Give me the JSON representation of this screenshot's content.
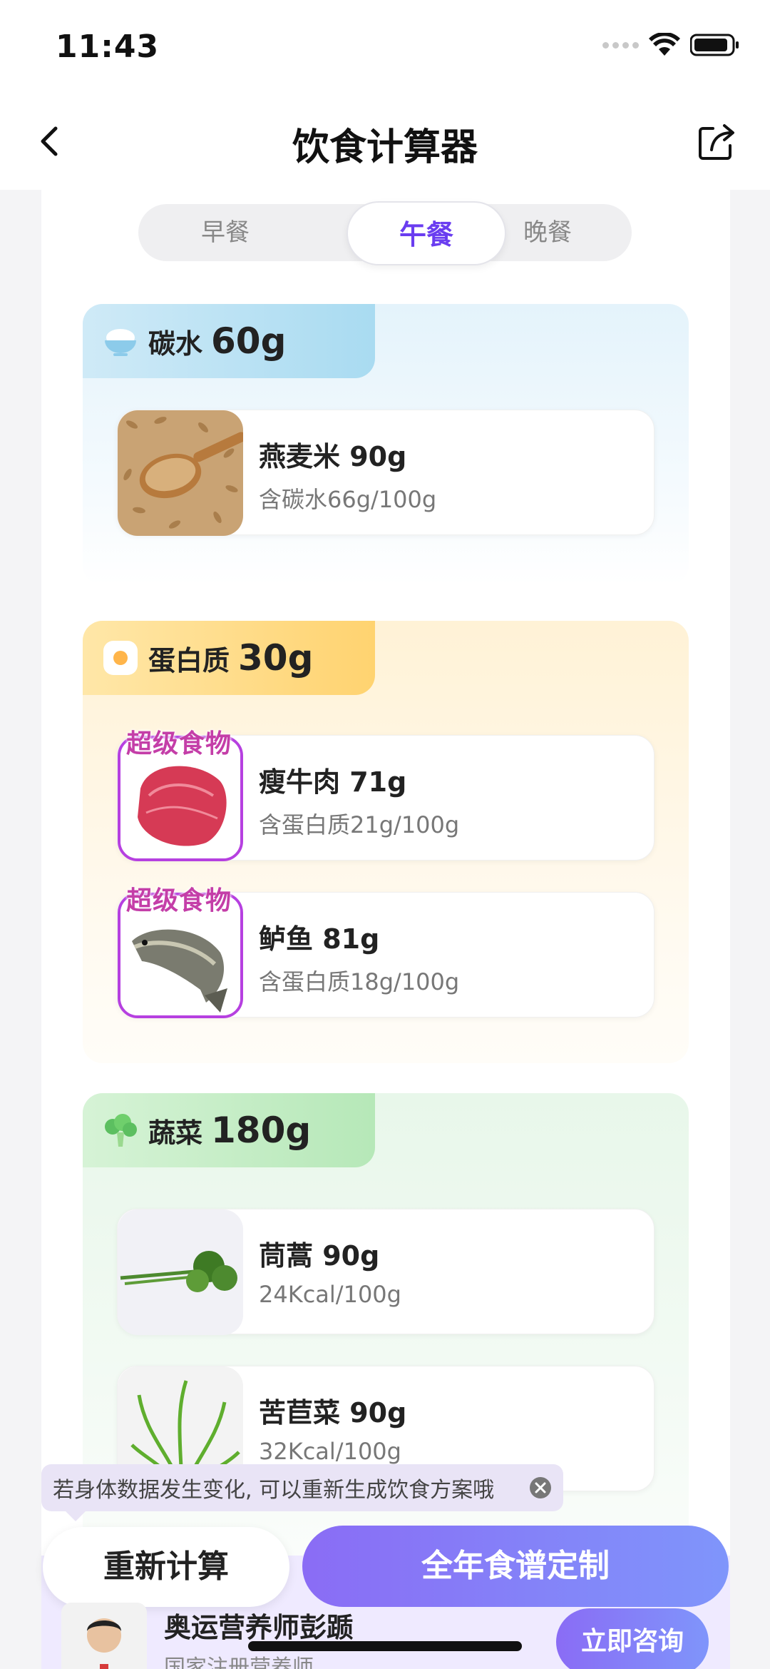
{
  "status": {
    "time": "11:43"
  },
  "nav": {
    "title": "饮食计算器"
  },
  "tabs": [
    {
      "label": "早餐",
      "active": false
    },
    {
      "label": "午餐",
      "active": true
    },
    {
      "label": "晚餐",
      "active": false
    }
  ],
  "sections": {
    "carb": {
      "name": "碳水",
      "amount": "60g",
      "icon": "rice-bowl-icon",
      "foods": [
        {
          "name": "燕麦米 90g",
          "desc": "含碳水66g/100g",
          "super": false
        }
      ]
    },
    "protein": {
      "name": "蛋白质",
      "amount": "30g",
      "icon": "egg-icon",
      "foods": [
        {
          "name": "瘦牛肉 71g",
          "desc": "含蛋白质21g/100g",
          "super": true,
          "badge": "超级食物"
        },
        {
          "name": "鲈鱼 81g",
          "desc": "含蛋白质18g/100g",
          "super": true,
          "badge": "超级食物"
        }
      ]
    },
    "veg": {
      "name": "蔬菜",
      "amount": "180g",
      "icon": "broccoli-icon",
      "foods": [
        {
          "name": "茼蒿 90g",
          "desc": "24Kcal/100g",
          "super": false
        },
        {
          "name": "苦苣菜 90g",
          "desc": "32Kcal/100g",
          "super": false
        }
      ]
    }
  },
  "tip": {
    "text": "若身体数据发生变化, 可以重新生成饮食方案哦"
  },
  "actions": {
    "recalc": "重新计算",
    "plan": "全年食谱定制"
  },
  "expert": {
    "name": "奥运营养师彭踬",
    "subtitle": "国家注册营养师",
    "consult": "立即咨询"
  },
  "colors": {
    "accent": "#6a3df0",
    "super_badge": "#c43ea8"
  }
}
